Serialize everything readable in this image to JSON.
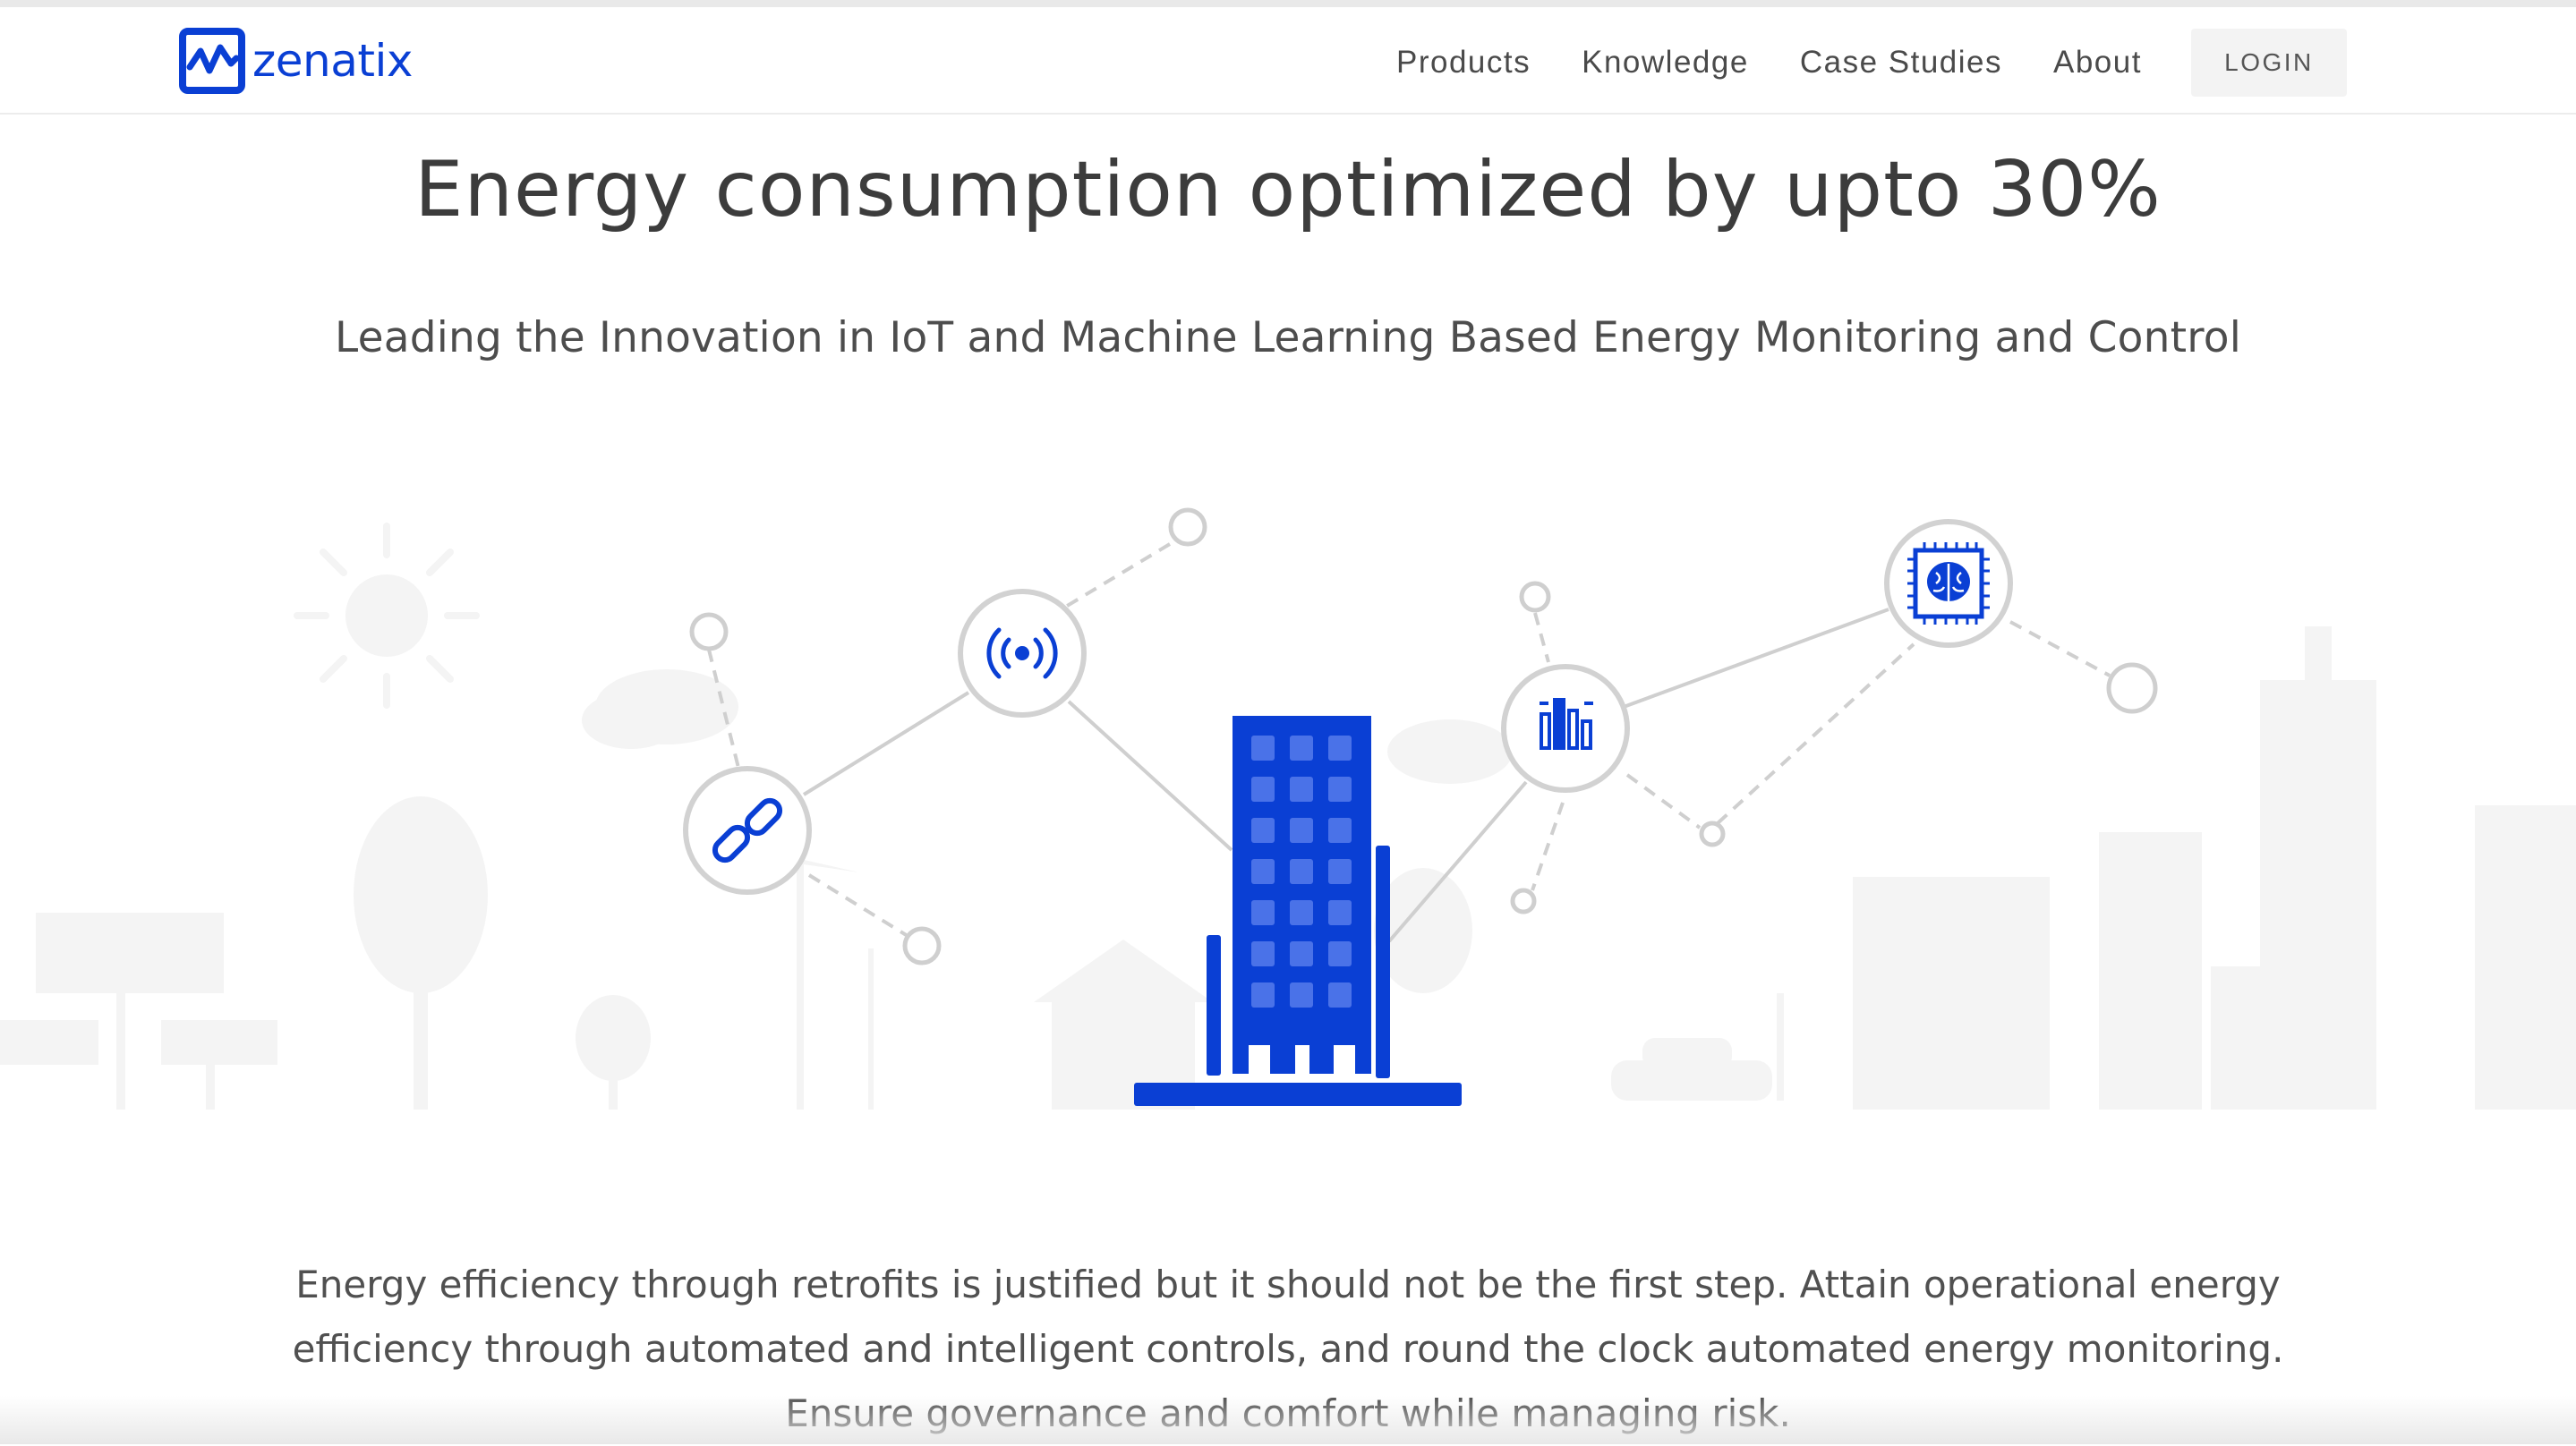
{
  "brand": {
    "name": "zenatix",
    "logo_icon": "pulse-square-icon",
    "color": "#0a3fd4"
  },
  "nav": {
    "items": [
      {
        "label": "Products"
      },
      {
        "label": "Knowledge"
      },
      {
        "label": "Case Studies"
      },
      {
        "label": "About"
      }
    ],
    "login_label": "LOGIN"
  },
  "hero": {
    "title": "Energy consumption optimized by upto 30%",
    "subtitle": "Leading the Innovation in IoT and Machine Learning Based Energy Monitoring and Control",
    "icons": [
      "link-icon",
      "wireless-signal-icon",
      "building-icon",
      "bar-chart-icon",
      "brain-chip-icon"
    ]
  },
  "description": "Energy efficiency through retrofits is justified but it should not be the first step. Attain operational energy efficiency through automated and intelligent controls, and round the clock automated energy monitoring. Ensure governance and comfort while managing risk.",
  "colors": {
    "accent": "#0a3fd4",
    "node_ring": "#cfcfcf",
    "background_silhouette": "#f4f4f4"
  }
}
